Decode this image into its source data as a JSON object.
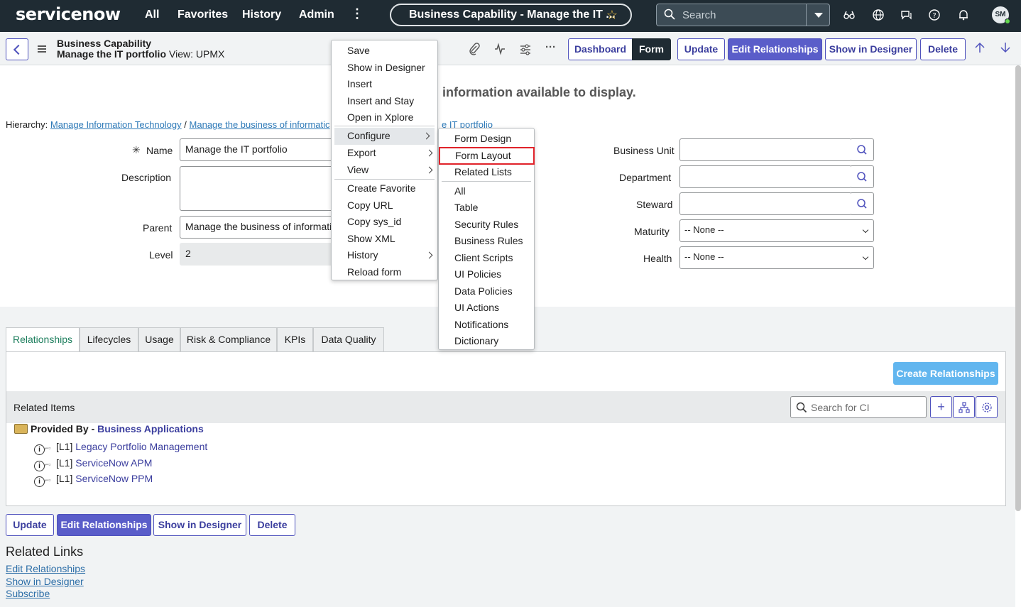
{
  "nav": {
    "brand": "servicenow",
    "links": [
      "All",
      "Favorites",
      "History",
      "Admin"
    ],
    "more": "⋮",
    "context_title": "Business Capability - Manage the IT ...",
    "search_placeholder": "Search",
    "user_initials": "SM"
  },
  "header": {
    "title_line1": "Business Capability",
    "title_line2": "Manage the IT portfolio",
    "view_label": "View: UPMX",
    "buttons": {
      "dashboard": "Dashboard",
      "form": "Form",
      "update": "Update",
      "edit_relationships": "Edit Relationships",
      "show_in_designer": "Show in Designer",
      "delete": "Delete"
    }
  },
  "form": {
    "no_data_message": "information available to display.",
    "hierarchy_label": "Hierarchy:",
    "hierarchy": [
      "Manage Information Technology",
      "Manage the business of informatic",
      "e IT portfolio"
    ],
    "hierarchy_sep": "/",
    "fields": {
      "name": {
        "label": "Name",
        "value": "Manage the IT portfolio"
      },
      "description": {
        "label": "Description",
        "value": ""
      },
      "parent": {
        "label": "Parent",
        "value": "Manage the business of informatic"
      },
      "level": {
        "label": "Level",
        "value": "2"
      },
      "business_unit": {
        "label": "Business Unit",
        "value": ""
      },
      "department": {
        "label": "Department",
        "value": ""
      },
      "steward": {
        "label": "Steward",
        "value": ""
      },
      "maturity": {
        "label": "Maturity",
        "value": "-- None --"
      },
      "health": {
        "label": "Health",
        "value": "-- None --"
      }
    }
  },
  "context_menu": {
    "items": [
      "Save",
      "Show in Designer",
      "Insert",
      "Insert and Stay",
      "Open in Xplore",
      "Configure",
      "Export",
      "View",
      "Create Favorite",
      "Copy URL",
      "Copy sys_id",
      "Show XML",
      "History",
      "Reload form"
    ]
  },
  "configure_submenu": {
    "items": [
      "Form Design",
      "Form Layout",
      "Related Lists",
      "All",
      "Table",
      "Security Rules",
      "Business Rules",
      "Client Scripts",
      "UI Policies",
      "Data Policies",
      "UI Actions",
      "Notifications",
      "Dictionary"
    ]
  },
  "tabs": [
    "Relationships",
    "Lifecycles",
    "Usage",
    "Risk & Compliance",
    "KPIs",
    "Data Quality"
  ],
  "relationships": {
    "create_button": "Create Relationships",
    "related_items_label": "Related Items",
    "ci_search_placeholder": "Search for CI",
    "group_prefix": "Provided By -",
    "group_link": "Business Applications",
    "rows": [
      {
        "level": "[L1]",
        "name": "Legacy Portfolio Management"
      },
      {
        "level": "[L1]",
        "name": "ServiceNow APM"
      },
      {
        "level": "[L1]",
        "name": "ServiceNow PPM"
      }
    ]
  },
  "bottom_buttons": {
    "update": "Update",
    "edit_relationships": "Edit Relationships",
    "show_in_designer": "Show in Designer",
    "delete": "Delete"
  },
  "related_links": {
    "title": "Related Links",
    "links": [
      "Edit Relationships",
      "Show in Designer",
      "Subscribe"
    ]
  },
  "colors": {
    "nav_bg": "#1f2b33",
    "accent": "#4f52bd",
    "primary_button": "#5a5dc9",
    "highlight_border": "#e0222a"
  }
}
